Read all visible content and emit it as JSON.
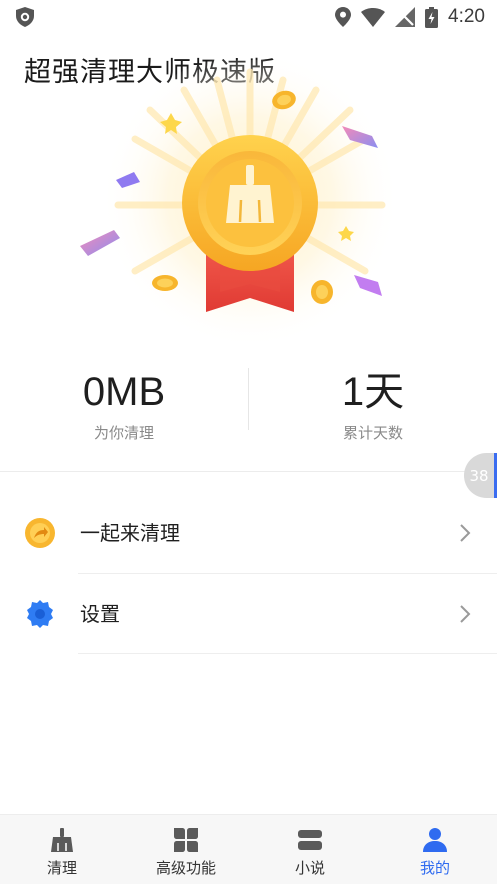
{
  "status_bar": {
    "time": "4:20"
  },
  "app": {
    "title": "超强清理大师极速版"
  },
  "stats": [
    {
      "value": "0MB",
      "label": "为你清理"
    },
    {
      "value": "1天",
      "label": "累计天数"
    }
  ],
  "floating_badge": "38",
  "menu": [
    {
      "label": "一起来清理",
      "icon": "share-arrow-icon"
    },
    {
      "label": "设置",
      "icon": "gear-icon"
    }
  ],
  "tabs": [
    {
      "label": "清理",
      "icon": "broom-icon",
      "active": false
    },
    {
      "label": "高级功能",
      "icon": "grid-icon",
      "active": false
    },
    {
      "label": "小说",
      "icon": "book-icon",
      "active": false
    },
    {
      "label": "我的",
      "icon": "person-icon",
      "active": true
    }
  ],
  "colors": {
    "accent": "#2F6BF0",
    "medal_gold": "#F7B52C",
    "ribbon_red": "#E8463C"
  }
}
